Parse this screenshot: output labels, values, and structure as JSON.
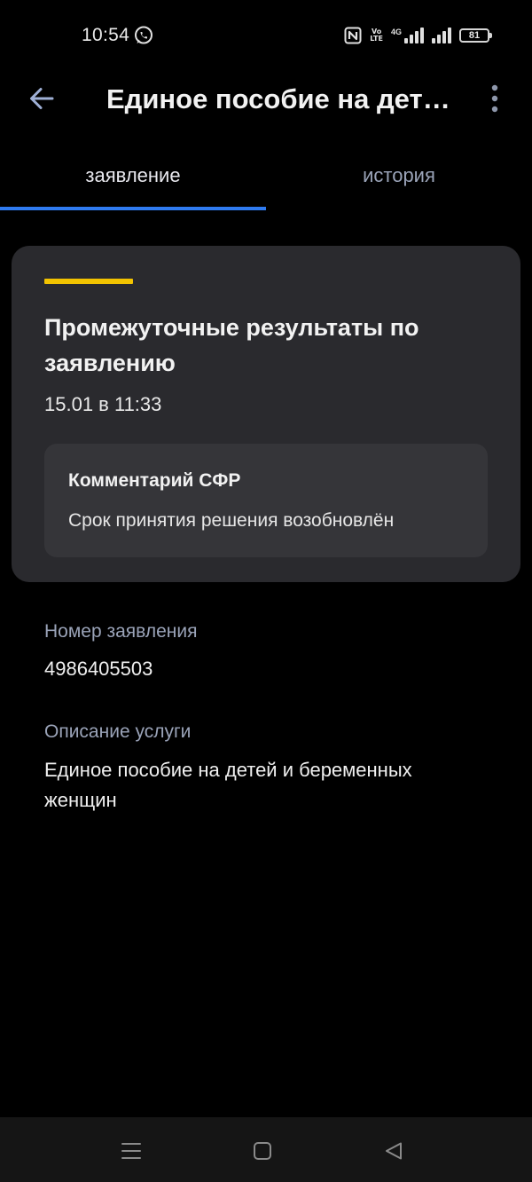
{
  "status_bar": {
    "time": "10:54",
    "volte_line1": "Vo",
    "volte_line2": "LTE",
    "network": "4G",
    "battery": "81"
  },
  "header": {
    "title": "Единое пособие на детей и беременных женщин"
  },
  "tabs": [
    {
      "label": "заявление"
    },
    {
      "label": "история"
    }
  ],
  "status_card": {
    "title": "Промежуточные результаты по заявлению",
    "date": "15.01 в 11:33",
    "comment_title": "Комментарий СФР",
    "comment_text": "Срок принятия решения возобновлён"
  },
  "details": {
    "number_label": "Номер заявления",
    "number_value": "4986405503",
    "description_label": "Описание услуги",
    "description_value": "Единое пособие на детей и беременных женщин"
  },
  "colors": {
    "background": "#000000",
    "card": "#2a2a2e",
    "accent_yellow": "#f2c300",
    "tab_indicator": "#2f7bf0",
    "muted_text": "#9aa3b8"
  },
  "icons": {
    "back": "arrow-left-icon",
    "more": "more-vertical-icon",
    "whatsapp": "whatsapp-icon",
    "nfc": "nfc-icon",
    "nav_recents": "menu-icon",
    "nav_home": "square-icon",
    "nav_back": "triangle-back-icon"
  }
}
